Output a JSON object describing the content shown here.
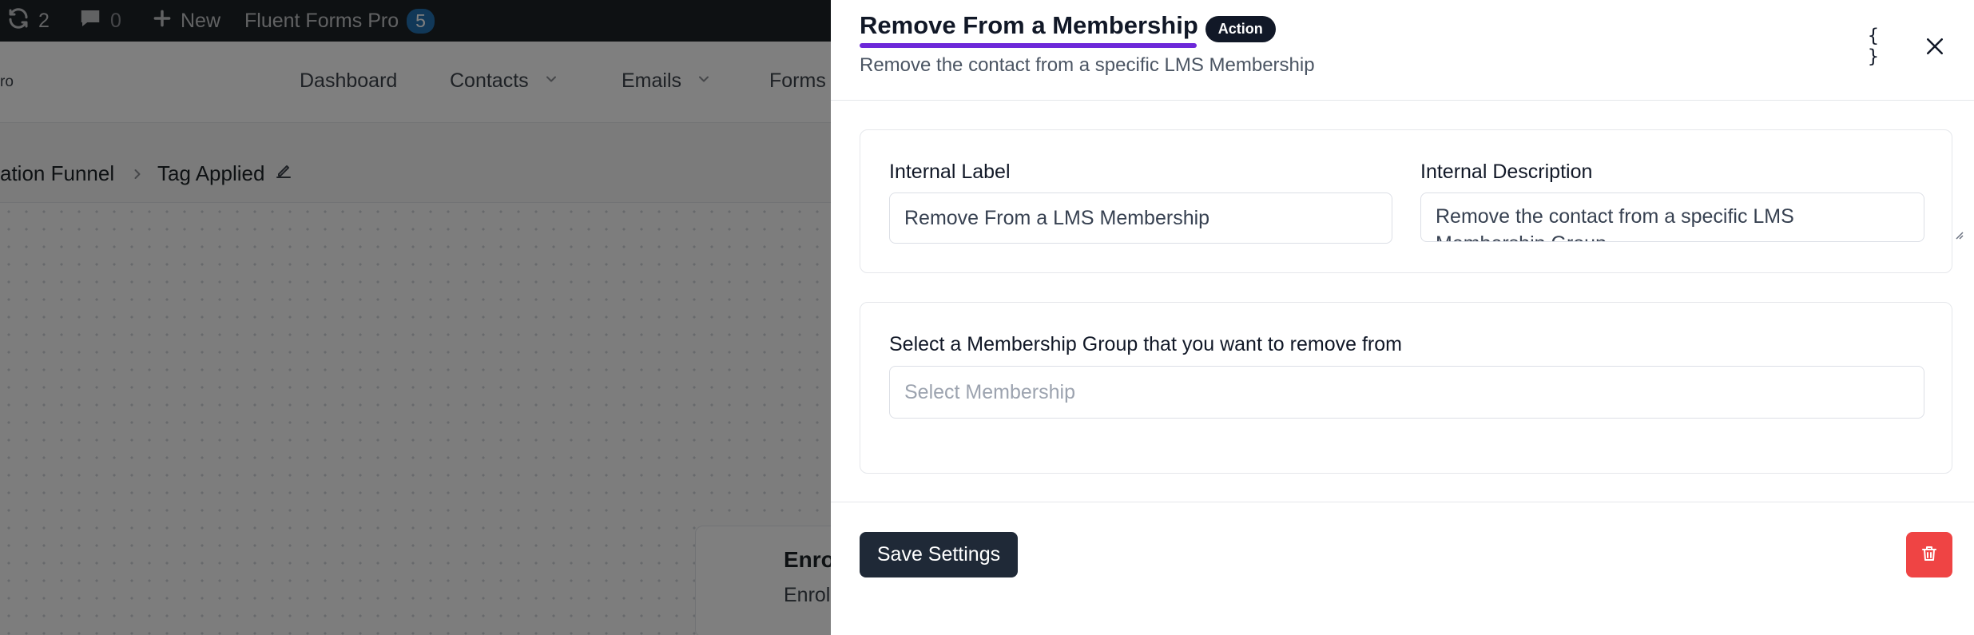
{
  "admin_bar": {
    "updates_count": "2",
    "comments_count": "0",
    "new_label": "New",
    "plugin_label": "Fluent Forms Pro",
    "plugin_badge": "5"
  },
  "app_nav": {
    "brand_fragment": "ro",
    "items": [
      {
        "label": "Dashboard"
      },
      {
        "label": "Contacts"
      },
      {
        "label": "Emails"
      },
      {
        "label": "Forms"
      }
    ]
  },
  "breadcrumb": {
    "parent": "ation Funnel",
    "current": "Tag Applied"
  },
  "canvas": {
    "node_title": "Enro",
    "node_sub": "Enrol"
  },
  "drawer": {
    "title": "Remove From a Membership",
    "badge": "Action",
    "subtitle": "Remove the contact from a specific LMS Membership",
    "internal_label": {
      "label": "Internal Label",
      "value": "Remove From a LMS Membership"
    },
    "internal_description": {
      "label": "Internal Description",
      "value": "Remove the contact from a specific LMS Membership Group"
    },
    "membership": {
      "label": "Select a Membership Group that you want to remove from",
      "placeholder": "Select Membership"
    },
    "save_label": "Save Settings"
  },
  "icons": {
    "updates": "refresh-icon",
    "comments": "comment-icon",
    "new": "plus-icon",
    "edit": "pencil-icon",
    "code": "braces-icon",
    "close": "close-icon",
    "delete": "trash-icon"
  },
  "colors": {
    "accent_underline": "#6d28d9",
    "primary_button": "#1f2937",
    "danger_button": "#ef4444",
    "admin_bar": "#1d2327",
    "badge_blue": "#2271b1"
  }
}
